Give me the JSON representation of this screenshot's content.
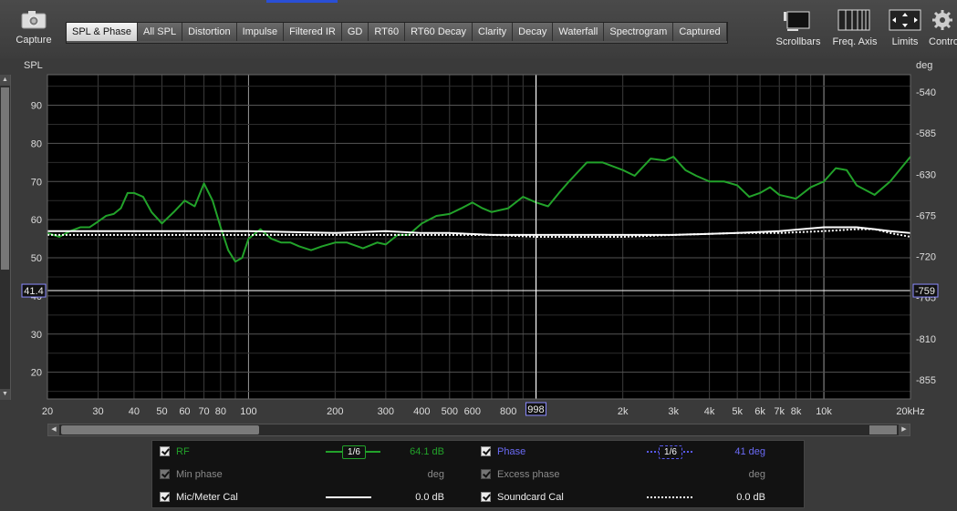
{
  "toolbar": {
    "capture_label": "Capture",
    "scrollbars_label": "Scrollbars",
    "freq_axis_label": "Freq. Axis",
    "limits_label": "Limits",
    "controls_label": "Contro"
  },
  "tabs": [
    "SPL & Phase",
    "All SPL",
    "Distortion",
    "Impulse",
    "Filtered IR",
    "GD",
    "RT60",
    "RT60 Decay",
    "Clarity",
    "Decay",
    "Waterfall",
    "Spectrogram",
    "Captured"
  ],
  "active_tab": "SPL & Phase",
  "axes": {
    "left_unit": "SPL",
    "right_unit": "deg",
    "left_ticks": [
      "90",
      "80",
      "70",
      "60",
      "50",
      "40",
      "30",
      "20"
    ],
    "right_ticks": [
      "-540",
      "-585",
      "-630",
      "-675",
      "-720",
      "-765",
      "-810",
      "-855"
    ],
    "x_ticks": [
      "20",
      "30",
      "40",
      "50",
      "60",
      "70",
      "80",
      "100",
      "200",
      "300",
      "400",
      "500",
      "600",
      "800",
      "1k",
      "2k",
      "3k",
      "4k",
      "5k",
      "6k",
      "7k",
      "8k",
      "10k",
      "20kHz"
    ],
    "cursor_freq": "998",
    "cursor_spl": "41.4",
    "cursor_deg": "-759"
  },
  "chart_data": {
    "type": "line",
    "xscale": "log",
    "xlim": [
      20,
      20000
    ],
    "ylim": [
      13,
      98
    ],
    "y2lim": [
      -876,
      -521
    ],
    "cursor": {
      "x": 998,
      "y": 41.4,
      "y2": -759
    },
    "series": [
      {
        "name": "RF",
        "color": "#22a22a",
        "axis": "left",
        "x": [
          20,
          22,
          24,
          26,
          28,
          30,
          32,
          34,
          36,
          38,
          40,
          43,
          46,
          50,
          55,
          60,
          65,
          70,
          75,
          80,
          85,
          90,
          95,
          100,
          110,
          120,
          130,
          140,
          150,
          165,
          180,
          200,
          220,
          250,
          280,
          300,
          330,
          360,
          400,
          450,
          500,
          550,
          600,
          650,
          700,
          800,
          900,
          1000,
          1100,
          1200,
          1300,
          1500,
          1700,
          2000,
          2200,
          2500,
          2800,
          3000,
          3300,
          3600,
          4000,
          4500,
          5000,
          5500,
          6000,
          6500,
          7000,
          8000,
          9000,
          10000,
          11000,
          12000,
          13000,
          15000,
          17000,
          20000
        ],
        "y": [
          56.5,
          55.5,
          57,
          58,
          58,
          59.5,
          61,
          61.5,
          63,
          67,
          67,
          66,
          62,
          59,
          62,
          65,
          63.5,
          69.5,
          65,
          58,
          52,
          49,
          50,
          55,
          57.5,
          55,
          54,
          54,
          53,
          52,
          53,
          54,
          54,
          52.5,
          54,
          53.5,
          56,
          56,
          59,
          61,
          61.5,
          63,
          64.5,
          63,
          62,
          63,
          66,
          64.5,
          63.5,
          67,
          70,
          75,
          75,
          73,
          71.5,
          76,
          75.5,
          76.5,
          73,
          71.5,
          70,
          70,
          69,
          66,
          67,
          68.5,
          66.5,
          65.5,
          68.5,
          70,
          73.5,
          73,
          69,
          66.5,
          70,
          76.5
        ]
      },
      {
        "name": "",
        "color": "#ffffff",
        "axis": "left",
        "style": "solid",
        "x": [
          20,
          50,
          100,
          200,
          300,
          400,
          500,
          700,
          1000,
          2000,
          3000,
          5000,
          7000,
          10000,
          13000,
          15000,
          17000,
          20000
        ],
        "y": [
          57,
          57,
          57,
          56.5,
          57,
          56.5,
          56.5,
          56,
          56,
          56,
          56,
          56.5,
          57,
          58,
          58,
          57.5,
          57,
          56.5
        ]
      },
      {
        "name": "",
        "color": "#ffffff",
        "axis": "left",
        "style": "dotted",
        "x": [
          20,
          50,
          100,
          200,
          300,
          400,
          500,
          700,
          1000,
          2000,
          3000,
          5000,
          7000,
          10000,
          13000,
          15000,
          17000,
          20000
        ],
        "y": [
          56,
          56,
          56,
          56,
          56,
          56,
          56,
          56,
          55.5,
          55.5,
          56,
          56.5,
          56.5,
          57,
          57.5,
          57.5,
          56.5,
          55.5
        ]
      }
    ]
  },
  "legend": {
    "rows": [
      {
        "left_label": "RF",
        "left_smoothing": "1/6",
        "left_value": "64.1 dB",
        "right_label": "Phase",
        "right_smoothing": "1/6",
        "right_value": "41 deg"
      },
      {
        "left_label": "Min phase",
        "left_value": "deg",
        "right_label": "Excess phase",
        "right_value": "deg"
      },
      {
        "left_label": "Mic/Meter Cal",
        "left_value": "0.0 dB",
        "right_label": "Soundcard Cal",
        "right_value": "0.0 dB"
      }
    ],
    "colors": {
      "rf": "#22a22a",
      "phase": "#5a5af0",
      "dim": "#8a8a8a",
      "white": "#ffffff"
    }
  }
}
